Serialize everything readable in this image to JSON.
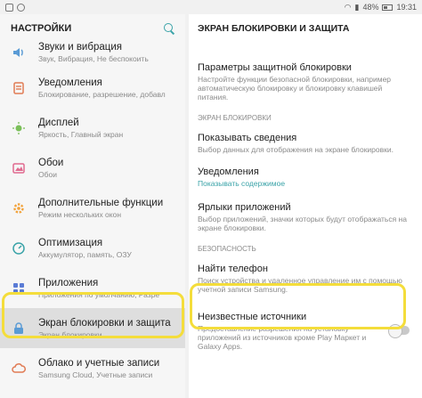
{
  "status_bar": {
    "signal": "48%",
    "time": "19:31"
  },
  "left": {
    "title": "НАСТРОЙКИ",
    "items": [
      {
        "icon": "sound-icon",
        "label": "Звуки и вибрация",
        "sub": "Звук, Вибрация, Не беспокоить",
        "color": "#5a9bd5"
      },
      {
        "icon": "notifications-icon",
        "label": "Уведомления",
        "sub": "Блокирование, разрешение, добавл",
        "color": "#e07b54"
      },
      {
        "icon": "display-icon",
        "label": "Дисплей",
        "sub": "Яркость, Главный экран",
        "color": "#7bbf5a"
      },
      {
        "icon": "wallpaper-icon",
        "label": "Обои",
        "sub": "Обои",
        "color": "#e06a8f"
      },
      {
        "icon": "advanced-features-icon",
        "label": "Дополнительные функции",
        "sub": "Режим нескольких окон",
        "color": "#f2a23a"
      },
      {
        "icon": "optimization-icon",
        "label": "Оптимизация",
        "sub": "Аккумулятор, память, ОЗУ",
        "color": "#3aa3a8"
      },
      {
        "icon": "apps-icon",
        "label": "Приложения",
        "sub": "Приложения по умолчанию, Разре",
        "color": "#5a7bd5"
      },
      {
        "icon": "lock-icon",
        "label": "Экран блокировки и защита",
        "sub": "Экран блокировки",
        "color": "#5a9bd5"
      },
      {
        "icon": "cloud-icon",
        "label": "Облако и учетные записи",
        "sub": "Samsung Cloud, Учетные записи",
        "color": "#e07b54"
      }
    ]
  },
  "right": {
    "title": "ЭКРАН БЛОКИРОВКИ И ЗАЩИТА",
    "item_security_params": {
      "label": "Параметры защитной блокировки",
      "sub": "Настройте функции безопасной блокировки, например автоматическую блокировку и блокировку клавишей питания."
    },
    "section_lock_screen": "ЭКРАН БЛОКИРОВКИ",
    "item_show_info": {
      "label": "Показывать сведения",
      "sub": "Выбор данных для отображения на экране блокировки."
    },
    "item_notifications": {
      "label": "Уведомления",
      "sub": "Показывать содержимое"
    },
    "item_app_shortcuts": {
      "label": "Ярлыки приложений",
      "sub": "Выбор приложений, значки которых будут отображаться на экране блокировки."
    },
    "section_security": "БЕЗОПАСНОСТЬ",
    "item_find_phone": {
      "label": "Найти телефон",
      "sub": "Поиск устройства и удаленное управление им с помощью учетной записи Samsung."
    },
    "item_unknown_sources": {
      "label": "Неизвестные источники",
      "sub": "Предоставление разрешения на установку приложений из источников кроме Play Маркет и Galaxy Apps."
    }
  },
  "colors": {
    "accent": "#3aa3a8",
    "highlight": "#f4dd3b"
  }
}
